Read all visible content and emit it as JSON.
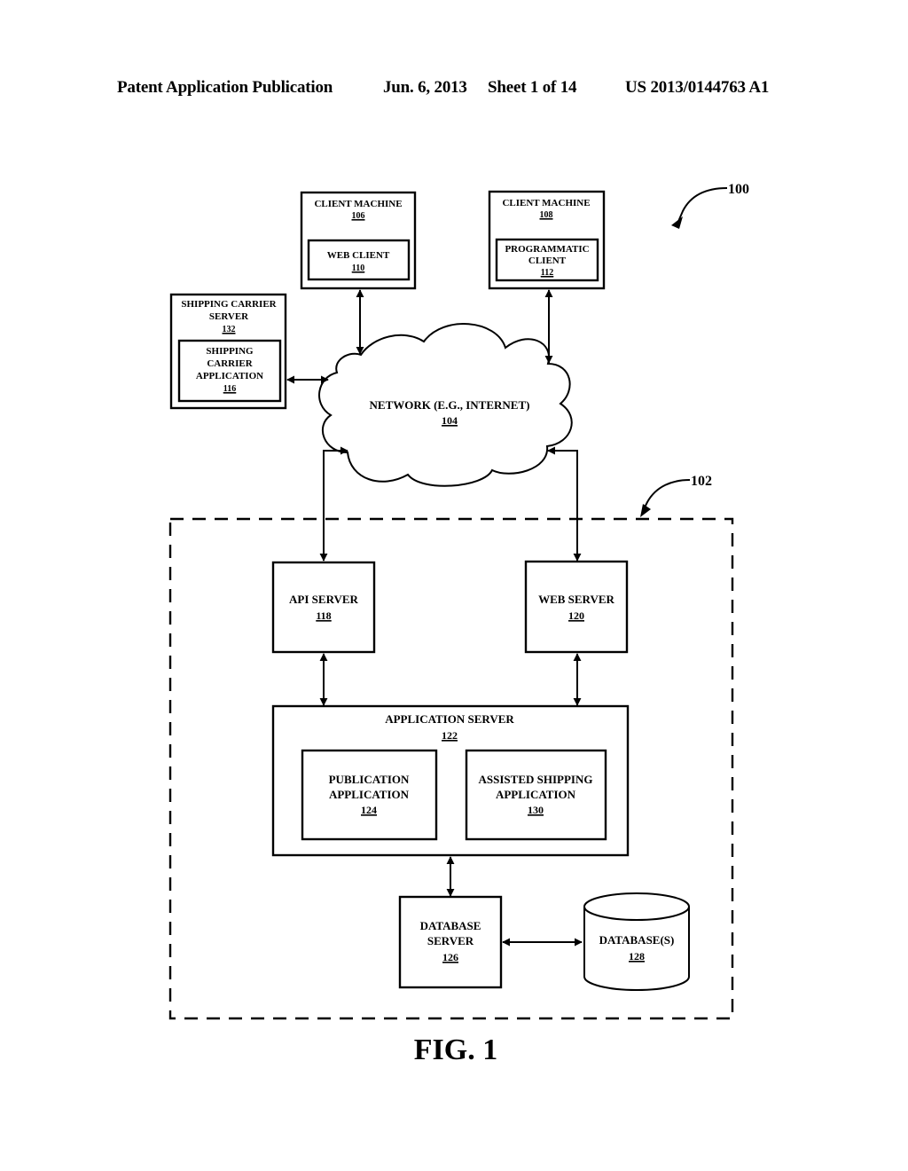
{
  "header": {
    "publication_type": "Patent Application Publication",
    "date": "Jun. 6, 2013",
    "sheet": "Sheet 1 of 14",
    "publication_number": "US 2013/0144763 A1"
  },
  "figure": {
    "caption": "FIG. 1",
    "system_ref": "100",
    "system_boundary_ref": "102",
    "nodes": {
      "client_machine_106": {
        "title": "CLIENT MACHINE",
        "ref": "106"
      },
      "web_client_110": {
        "title": "WEB CLIENT",
        "ref": "110"
      },
      "client_machine_108": {
        "title": "CLIENT MACHINE",
        "ref": "108"
      },
      "programmatic_client_112": {
        "line1": "PROGRAMMATIC",
        "line2": "CLIENT",
        "ref": "112"
      },
      "shipping_carrier_server_132": {
        "line1": "SHIPPING CARRIER",
        "line2": "SERVER",
        "ref": "132"
      },
      "shipping_carrier_application_116": {
        "line1": "SHIPPING",
        "line2": "CARRIER",
        "line3": "APPLICATION",
        "ref": "116"
      },
      "network_104": {
        "title": "NETWORK (E.G., INTERNET)",
        "ref": "104"
      },
      "api_server_118": {
        "title": "API SERVER",
        "ref": "118"
      },
      "web_server_120": {
        "title": "WEB SERVER",
        "ref": "120"
      },
      "application_server_122": {
        "title": "APPLICATION SERVER",
        "ref": "122"
      },
      "publication_application_124": {
        "line1": "PUBLICATION",
        "line2": "APPLICATION",
        "ref": "124"
      },
      "assisted_shipping_application_130": {
        "line1": "ASSISTED SHIPPING",
        "line2": "APPLICATION",
        "ref": "130"
      },
      "database_server_126": {
        "line1": "DATABASE",
        "line2": "SERVER",
        "ref": "126"
      },
      "databases_128": {
        "title": "DATABASE(S)",
        "ref": "128"
      }
    },
    "connections": [
      {
        "from": "client_machine_106",
        "to": "network_104",
        "type": "bidirectional"
      },
      {
        "from": "client_machine_108",
        "to": "network_104",
        "type": "bidirectional"
      },
      {
        "from": "shipping_carrier_server_132",
        "to": "network_104",
        "type": "bidirectional"
      },
      {
        "from": "network_104",
        "to": "api_server_118",
        "type": "bidirectional"
      },
      {
        "from": "network_104",
        "to": "web_server_120",
        "type": "bidirectional"
      },
      {
        "from": "api_server_118",
        "to": "application_server_122",
        "type": "bidirectional"
      },
      {
        "from": "web_server_120",
        "to": "application_server_122",
        "type": "bidirectional"
      },
      {
        "from": "application_server_122",
        "to": "database_server_126",
        "type": "bidirectional"
      },
      {
        "from": "database_server_126",
        "to": "databases_128",
        "type": "bidirectional"
      }
    ]
  }
}
